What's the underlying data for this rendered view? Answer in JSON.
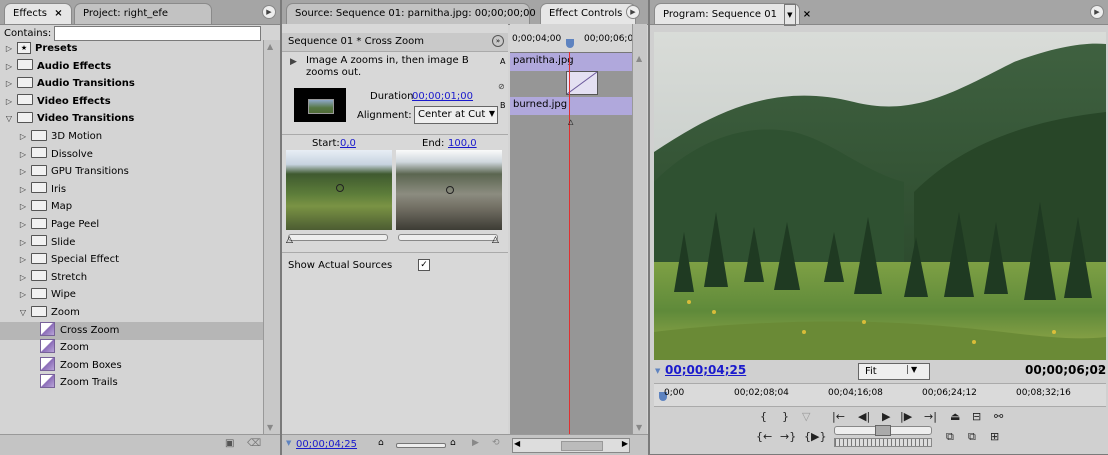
{
  "effects_panel": {
    "tab_active": "Effects",
    "tab_close": "×",
    "tab_other": "Project: right_efe",
    "contains_label": "Contains:",
    "contains_value": "",
    "items": [
      {
        "label": "Presets",
        "bold": true,
        "level": 0,
        "expanded": false,
        "icon": "presets"
      },
      {
        "label": "Audio Effects",
        "bold": true,
        "level": 0,
        "expanded": false,
        "icon": "folder"
      },
      {
        "label": "Audio Transitions",
        "bold": true,
        "level": 0,
        "expanded": false,
        "icon": "folder"
      },
      {
        "label": "Video Effects",
        "bold": true,
        "level": 0,
        "expanded": false,
        "icon": "folder"
      },
      {
        "label": "Video Transitions",
        "bold": true,
        "level": 0,
        "expanded": true,
        "icon": "folder"
      },
      {
        "label": "3D Motion",
        "bold": false,
        "level": 1,
        "expanded": false,
        "icon": "folder"
      },
      {
        "label": "Dissolve",
        "bold": false,
        "level": 1,
        "expanded": false,
        "icon": "folder"
      },
      {
        "label": "GPU Transitions",
        "bold": false,
        "level": 1,
        "expanded": false,
        "icon": "folder"
      },
      {
        "label": "Iris",
        "bold": false,
        "level": 1,
        "expanded": false,
        "icon": "folder"
      },
      {
        "label": "Map",
        "bold": false,
        "level": 1,
        "expanded": false,
        "icon": "folder"
      },
      {
        "label": "Page Peel",
        "bold": false,
        "level": 1,
        "expanded": false,
        "icon": "folder"
      },
      {
        "label": "Slide",
        "bold": false,
        "level": 1,
        "expanded": false,
        "icon": "folder"
      },
      {
        "label": "Special Effect",
        "bold": false,
        "level": 1,
        "expanded": false,
        "icon": "folder"
      },
      {
        "label": "Stretch",
        "bold": false,
        "level": 1,
        "expanded": false,
        "icon": "folder"
      },
      {
        "label": "Wipe",
        "bold": false,
        "level": 1,
        "expanded": false,
        "icon": "folder"
      },
      {
        "label": "Zoom",
        "bold": false,
        "level": 1,
        "expanded": true,
        "icon": "folder"
      },
      {
        "label": "Cross Zoom",
        "bold": false,
        "level": 2,
        "icon": "transition",
        "selected": true
      },
      {
        "label": "Zoom",
        "bold": false,
        "level": 2,
        "icon": "transition"
      },
      {
        "label": "Zoom Boxes",
        "bold": false,
        "level": 2,
        "icon": "transition"
      },
      {
        "label": "Zoom Trails",
        "bold": false,
        "level": 2,
        "icon": "transition"
      }
    ]
  },
  "effect_controls": {
    "tab_source": "Source: Sequence 01: parnitha.jpg: 00;00;00;00",
    "tab_active": "Effect Controls",
    "header": "Sequence 01 * Cross Zoom",
    "description": "Image A zooms in, then image B zooms out.",
    "duration_label": "Duration",
    "duration_value": "00;00;01;00",
    "alignment_label": "Alignment:",
    "alignment_value": "Center at Cut",
    "start_label": "Start:",
    "start_value": "0,0",
    "end_label": "End:",
    "end_value": "100,0",
    "show_sources_label": "Show Actual Sources",
    "show_sources_checked": true,
    "footer_time": "00;00;04;25",
    "letter_a": "A",
    "letter_b": "B"
  },
  "timeline_mini": {
    "time_left": "0;00;04;00",
    "time_right": "00;00;06;0",
    "clip_a": "parnitha.jpg",
    "clip_b": "burned.jpg"
  },
  "program_monitor": {
    "tab_label": "Program: Sequence 01",
    "tab_close": "×",
    "current_time": "00;00;04;25",
    "fit_label": "Fit",
    "duration": "00;00;06;02",
    "ruler": [
      "0;00",
      "00;02;08;04",
      "00;04;16;08",
      "00;06;24;12",
      "00;08;32;16"
    ]
  },
  "colors": {
    "accent_blue": "#1a1acc",
    "playhead_red": "#e03030",
    "clip_purple": "#b0a8dc"
  }
}
